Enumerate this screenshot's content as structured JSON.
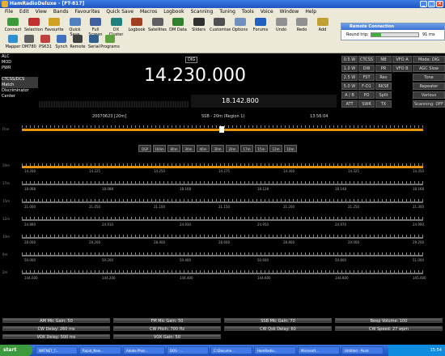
{
  "window": {
    "title": "HamRadioDeluxe - [FT-817]"
  },
  "menu": [
    "File",
    "Edit",
    "View",
    "Bands",
    "Favourites",
    "Quick Save",
    "Macros",
    "Logbook",
    "Scanning",
    "Tuning",
    "Tools",
    "Voice",
    "Window",
    "Help"
  ],
  "toolbar": [
    {
      "label": "Connect",
      "color": "#3a9a3a"
    },
    {
      "label": "Selection",
      "color": "#c03030"
    },
    {
      "label": "Favourite",
      "color": "#d0a020"
    },
    {
      "label": "Quick Save",
      "color": "#5080c0"
    },
    {
      "label": "Full Screen",
      "color": "#4060a0"
    },
    {
      "label": "DX Cluster",
      "color": "#208080"
    },
    {
      "label": "Logbook",
      "color": "#a04020"
    },
    {
      "label": "Satellites",
      "color": "#606060"
    },
    {
      "label": "DM Data",
      "color": "#308030"
    },
    {
      "label": "Sliders",
      "color": "#303030"
    },
    {
      "label": "Customise",
      "color": "#505050"
    },
    {
      "label": "Options",
      "color": "#7090c0"
    },
    {
      "label": "Forums",
      "color": "#2060c0"
    },
    {
      "label": "Undo",
      "color": "#909090"
    },
    {
      "label": "Redo",
      "color": "#909090"
    },
    {
      "label": "Add",
      "color": "#c0a030"
    }
  ],
  "toolbar2": [
    {
      "label": "Mapper",
      "color": "#3090d0"
    },
    {
      "label": "DM780",
      "color": "#606060"
    },
    {
      "label": "PSK31",
      "color": "#c04040"
    },
    {
      "label": "Synch",
      "color": "#4070c0"
    },
    {
      "label": "Remote",
      "color": "#404040"
    },
    {
      "label": "Serial",
      "color": "#306090"
    },
    {
      "label": "Programs",
      "color": "#60a040"
    }
  ],
  "remote": {
    "title": "Remote Connection",
    "label": "Round trip:",
    "value": 0.2,
    "ms": "91 ms"
  },
  "left_panel": [
    "ALC",
    "MOD",
    "PWR",
    "",
    "CTCSS/DCS Match",
    "Discriminator Center"
  ],
  "display": {
    "mode": "DIG",
    "frequency": "14.230.000",
    "sub_frequency": "18.142.800"
  },
  "right_buttons": [
    [
      "0.5 W",
      "CTCSS",
      "NB",
      "VFO A",
      "Mode: DIG"
    ],
    [
      "1.0 W",
      "DW",
      "PR",
      "VFO B",
      "AGC Slow"
    ],
    [
      "2.5 W",
      "FST",
      "Rev",
      "",
      "Tone"
    ],
    [
      "5.0 W",
      "F-D1",
      "RKSE",
      "",
      "Repeater"
    ],
    [
      "A / B",
      "PO",
      "Split",
      "",
      "Various"
    ],
    [
      "ATT",
      "SWR",
      "TX",
      "",
      "Scanning: OFF"
    ]
  ],
  "info": {
    "left": "20070623 [20m]",
    "center": "SSB - 20m (Region 1)",
    "right": "13:56:04"
  },
  "bands": [
    "DSP",
    "160m",
    "80m",
    "30m",
    "40m",
    "30m",
    "20m",
    "17m",
    "15m",
    "12m",
    "10m"
  ],
  "scale_rows": [
    {
      "label": "20m",
      "ticks": [
        "14.200",
        "14.225",
        "14.250",
        "14.275",
        "14.300",
        "14.325",
        "14.350"
      ]
    },
    {
      "label": "17m",
      "ticks": [
        "18.068",
        "18.088",
        "18.108",
        "18.128",
        "18.148",
        "18.168"
      ]
    },
    {
      "label": "15m",
      "ticks": [
        "21.000",
        "21.050",
        "21.100",
        "21.150",
        "21.200",
        "21.250",
        "21.300"
      ]
    },
    {
      "label": "12m",
      "ticks": [
        "24.890",
        "24.910",
        "24.930",
        "24.950",
        "24.970",
        "24.990"
      ]
    },
    {
      "label": "10m",
      "ticks": [
        "28.000",
        "28.200",
        "28.400",
        "28.600",
        "28.800",
        "29.000",
        "29.200"
      ]
    },
    {
      "label": "6m",
      "ticks": [
        "50.000",
        "50.200",
        "50.400",
        "50.600",
        "50.800",
        "51.000"
      ]
    },
    {
      "label": "2m",
      "ticks": [
        "144.000",
        "144.200",
        "144.400",
        "144.600",
        "144.800",
        "145.000"
      ]
    }
  ],
  "sliders": [
    {
      "label": "AM Mic Gain: 50"
    },
    {
      "label": "FM Mic Gain: 50"
    },
    {
      "label": "SSB Mic Gain: 70"
    },
    {
      "label": "Beep Volume: 100"
    },
    {
      "label": "CW Delay: 260 ms"
    },
    {
      "label": "CW Pitch: 700 Hz"
    },
    {
      "label": "CW Qsk Delay: 60"
    },
    {
      "label": "CW Speed: 27 wpm"
    },
    {
      "label": "VOX Delay: 500 ms"
    },
    {
      "label": "VOX Gain: 50"
    }
  ],
  "taskbar": {
    "start": "start",
    "tasks": [
      "WATNET_T...",
      "Rapid_New...",
      "Adobe Phot...",
      "DOS - ...",
      "C:\\Docume...",
      "HamRadio...",
      "Microsoft...",
      "Untitled - Paint"
    ],
    "tray": "15:54"
  }
}
